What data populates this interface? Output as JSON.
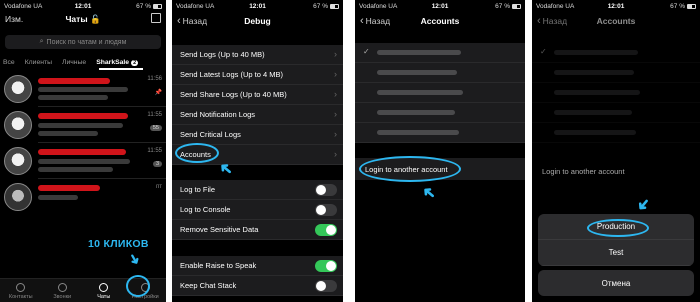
{
  "status": {
    "carrier": "Vodafone UA",
    "time": "12:01",
    "battery": "67 %"
  },
  "panel1": {
    "edit_label": "Изм.",
    "title": "Чаты",
    "search_placeholder": "Поиск по чатам и людям",
    "tabs": [
      "Все",
      "Клиенты",
      "Личные",
      "SharkSale"
    ],
    "sharksale_badge": "2",
    "chat_times": [
      "11:56",
      "11:55",
      "11:55",
      "пт"
    ],
    "chat_pills": [
      "",
      "55",
      "3",
      ""
    ],
    "clicks_label": "10 КЛИКОВ",
    "bottom_tabs": [
      "Контакты",
      "Звонки",
      "Чаты",
      "Настройки"
    ]
  },
  "panel2": {
    "back_label": "Назад",
    "title": "Debug",
    "group1": [
      "Send Logs (Up to 40 MB)",
      "Send Latest Logs (Up to 4 MB)",
      "Send Share Logs (Up to 40 MB)",
      "Send Notification Logs",
      "Send Critical Logs",
      "Accounts"
    ],
    "group2": [
      {
        "label": "Log to File",
        "on": false
      },
      {
        "label": "Log to Console",
        "on": false
      },
      {
        "label": "Remove Sensitive Data",
        "on": true
      }
    ],
    "group3": [
      {
        "label": "Enable Raise to Speak",
        "on": true
      },
      {
        "label": "Keep Chat Stack",
        "on": false
      }
    ]
  },
  "panel3": {
    "back_label": "Назад",
    "title": "Accounts",
    "login_label": "Login to another account"
  },
  "panel4": {
    "back_label": "Назад",
    "title": "Accounts",
    "login_label": "Login to another account",
    "sheet_options": [
      "Production",
      "Test"
    ],
    "cancel_label": "Отмена"
  },
  "colors": {
    "accent_annotation": "#2db7f0",
    "toggle_on": "#34c759",
    "redaction": "#d0141a"
  }
}
